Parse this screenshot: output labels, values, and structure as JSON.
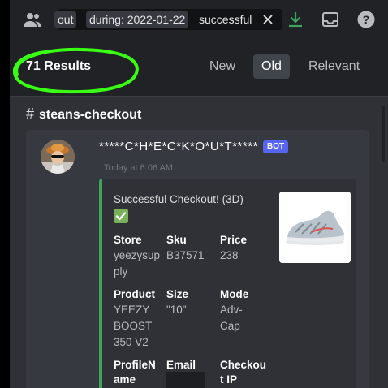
{
  "toolbar": {
    "search_chip_1": "out",
    "search_chip_2": "during: 2022-01-22",
    "search_tail": "successful",
    "icons": [
      "members-icon",
      "clear-icon",
      "download-icon",
      "inbox-icon",
      "help-icon"
    ]
  },
  "results": {
    "count_label": "71 Results",
    "sort_tabs": [
      {
        "label": "New",
        "active": false
      },
      {
        "label": "Old",
        "active": true
      },
      {
        "label": "Relevant",
        "active": false
      }
    ]
  },
  "channel": {
    "hash": "#",
    "name": "steans-checkout"
  },
  "message": {
    "username": "*****C*H*E*C*K*O*U*T*****",
    "badge": "BOT",
    "timestamp": "Today at 6:06 AM",
    "embed": {
      "accent_color": "#3ba55d",
      "title": "Successful Checkout! (3D)",
      "fields": [
        {
          "name": "Store",
          "value": "yeezysupply"
        },
        {
          "name": "Sku",
          "value": "B37571"
        },
        {
          "name": "Price",
          "value": "238"
        },
        {
          "name": "Product",
          "value": "YEEZY BOOST 350 V2"
        },
        {
          "name": "Size",
          "value": "\"10\""
        },
        {
          "name": "Mode",
          "value": "Adv-Cap"
        },
        {
          "name": "ProfileName",
          "value": ""
        },
        {
          "name": "Email",
          "value": ""
        },
        {
          "name": "Checkout IP",
          "value": ""
        }
      ]
    }
  },
  "colors": {
    "background": "#2f3136",
    "header": "#202225",
    "highlight_circle": "#39ff14",
    "bot_badge": "#5865f2",
    "download_icon": "#3ba55d"
  }
}
